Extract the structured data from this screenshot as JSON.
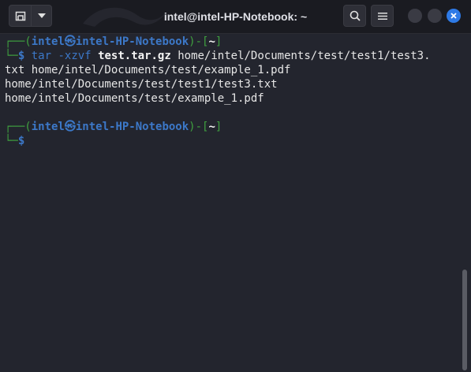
{
  "window": {
    "title": "intel@intel-HP-Notebook: ~"
  },
  "icons": {
    "new_tab": "new-tab-icon",
    "dropdown": "chevron-down-icon",
    "search": "search-icon",
    "menu": "hamburger-menu-icon",
    "minimize": "minimize-icon",
    "maximize": "maximize-icon",
    "close": "close-icon"
  },
  "colors": {
    "background": "#23252e",
    "titlebar": "#1a1b21",
    "prompt_frame": "#3fa03f",
    "prompt_user": "#3c78c8",
    "close_button": "#2e7ae6"
  },
  "terminal": {
    "prompt1": {
      "open": "┌──(",
      "user": "intel",
      "at": "㉿",
      "host": "intel-HP-Notebook",
      "mid": ")-[",
      "dir": "~",
      "close": "]",
      "corner": "└─",
      "dollar": "$",
      "cmd": "tar",
      "flags": "-xzvf",
      "archive": "test.tar.gz",
      "args": "home/intel/Documents/test/test1/test3."
    },
    "output": [
      "txt home/intel/Documents/test/example_1.pdf",
      "home/intel/Documents/test/test1/test3.txt",
      "home/intel/Documents/test/example_1.pdf"
    ],
    "prompt2": {
      "open": "┌──(",
      "user": "intel",
      "at": "㉿",
      "host": "intel-HP-Notebook",
      "mid": ")-[",
      "dir": "~",
      "close": "]",
      "corner": "└─",
      "dollar": "$"
    }
  }
}
